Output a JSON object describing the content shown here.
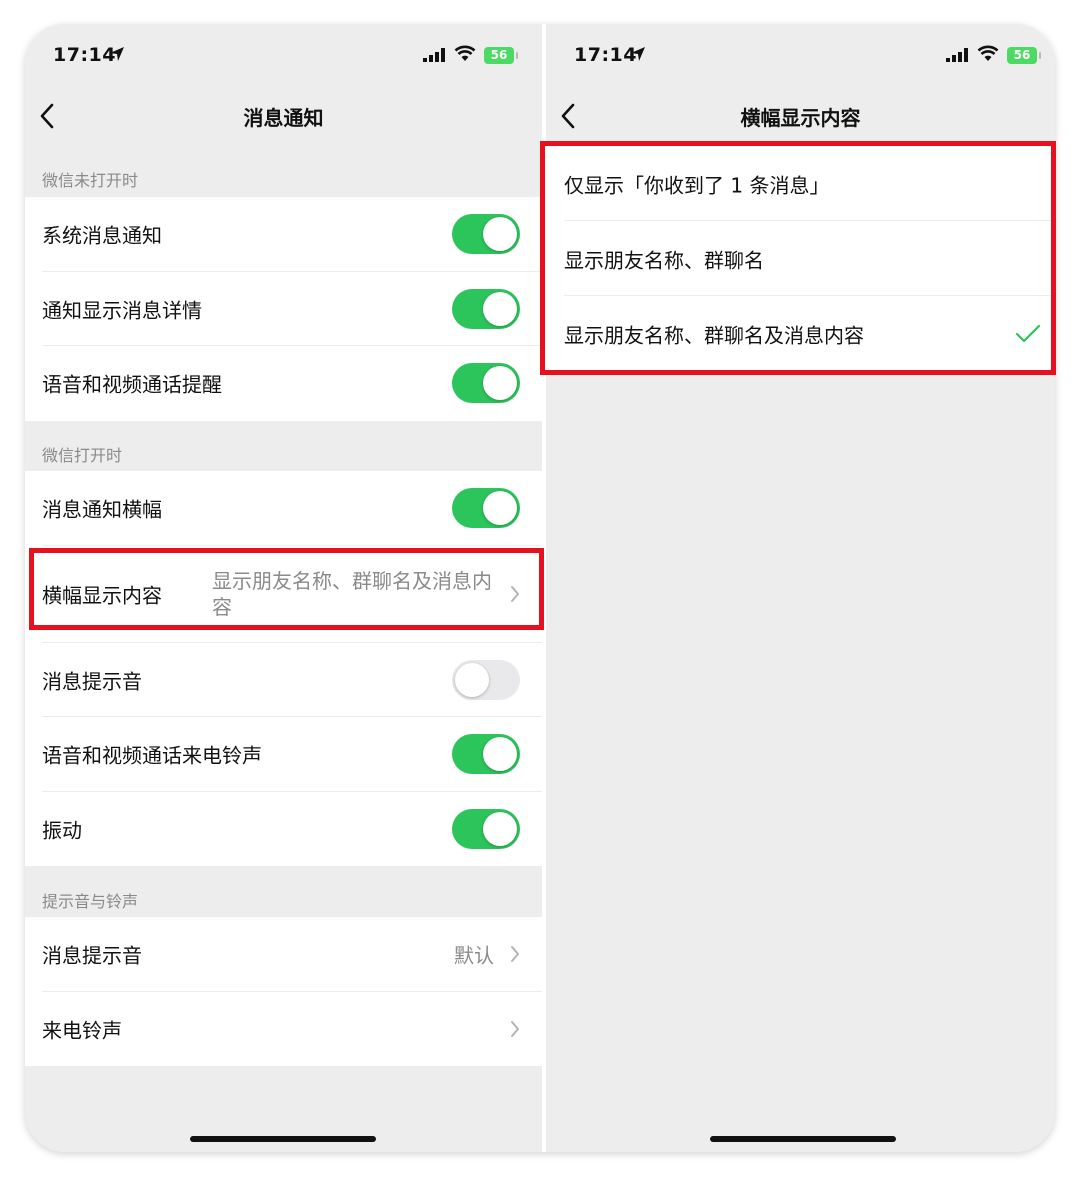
{
  "left": {
    "status": {
      "time": "17:14",
      "battery": "56"
    },
    "title": "消息通知",
    "sections": [
      {
        "label": "微信未打开时",
        "rows": [
          {
            "label": "系统消息通知",
            "toggle": true
          },
          {
            "label": "通知显示消息详情",
            "toggle": true
          },
          {
            "label": "语音和视频通话提醒",
            "toggle": true
          }
        ]
      },
      {
        "label": "微信打开时",
        "rows": [
          {
            "label": "消息通知横幅",
            "toggle": true
          },
          {
            "label": "横幅显示内容",
            "value": "显示朋友名称、群聊名及消息内容"
          },
          {
            "label": "消息提示音",
            "toggle": false
          },
          {
            "label": "语音和视频通话来电铃声",
            "toggle": true
          },
          {
            "label": "振动",
            "toggle": true
          }
        ]
      },
      {
        "label": "提示音与铃声",
        "rows": [
          {
            "label": "消息提示音",
            "value": "默认"
          },
          {
            "label": "来电铃声",
            "value": ""
          }
        ]
      }
    ]
  },
  "right": {
    "status": {
      "time": "17:14",
      "battery": "56"
    },
    "title": "横幅显示内容",
    "options": [
      {
        "label": "仅显示「你收到了 1 条消息」",
        "selected": false
      },
      {
        "label": "显示朋友名称、群聊名",
        "selected": false
      },
      {
        "label": "显示朋友名称、群聊名及消息内容",
        "selected": true
      }
    ]
  },
  "colors": {
    "toggle_on": "#2bc55b",
    "highlight": "#e6101e",
    "check": "#2bc55b"
  },
  "icons": [
    "location-arrow-icon",
    "signal-icon",
    "wifi-icon",
    "battery-icon",
    "back-chevron-icon",
    "chevron-right-icon",
    "checkmark-icon"
  ]
}
